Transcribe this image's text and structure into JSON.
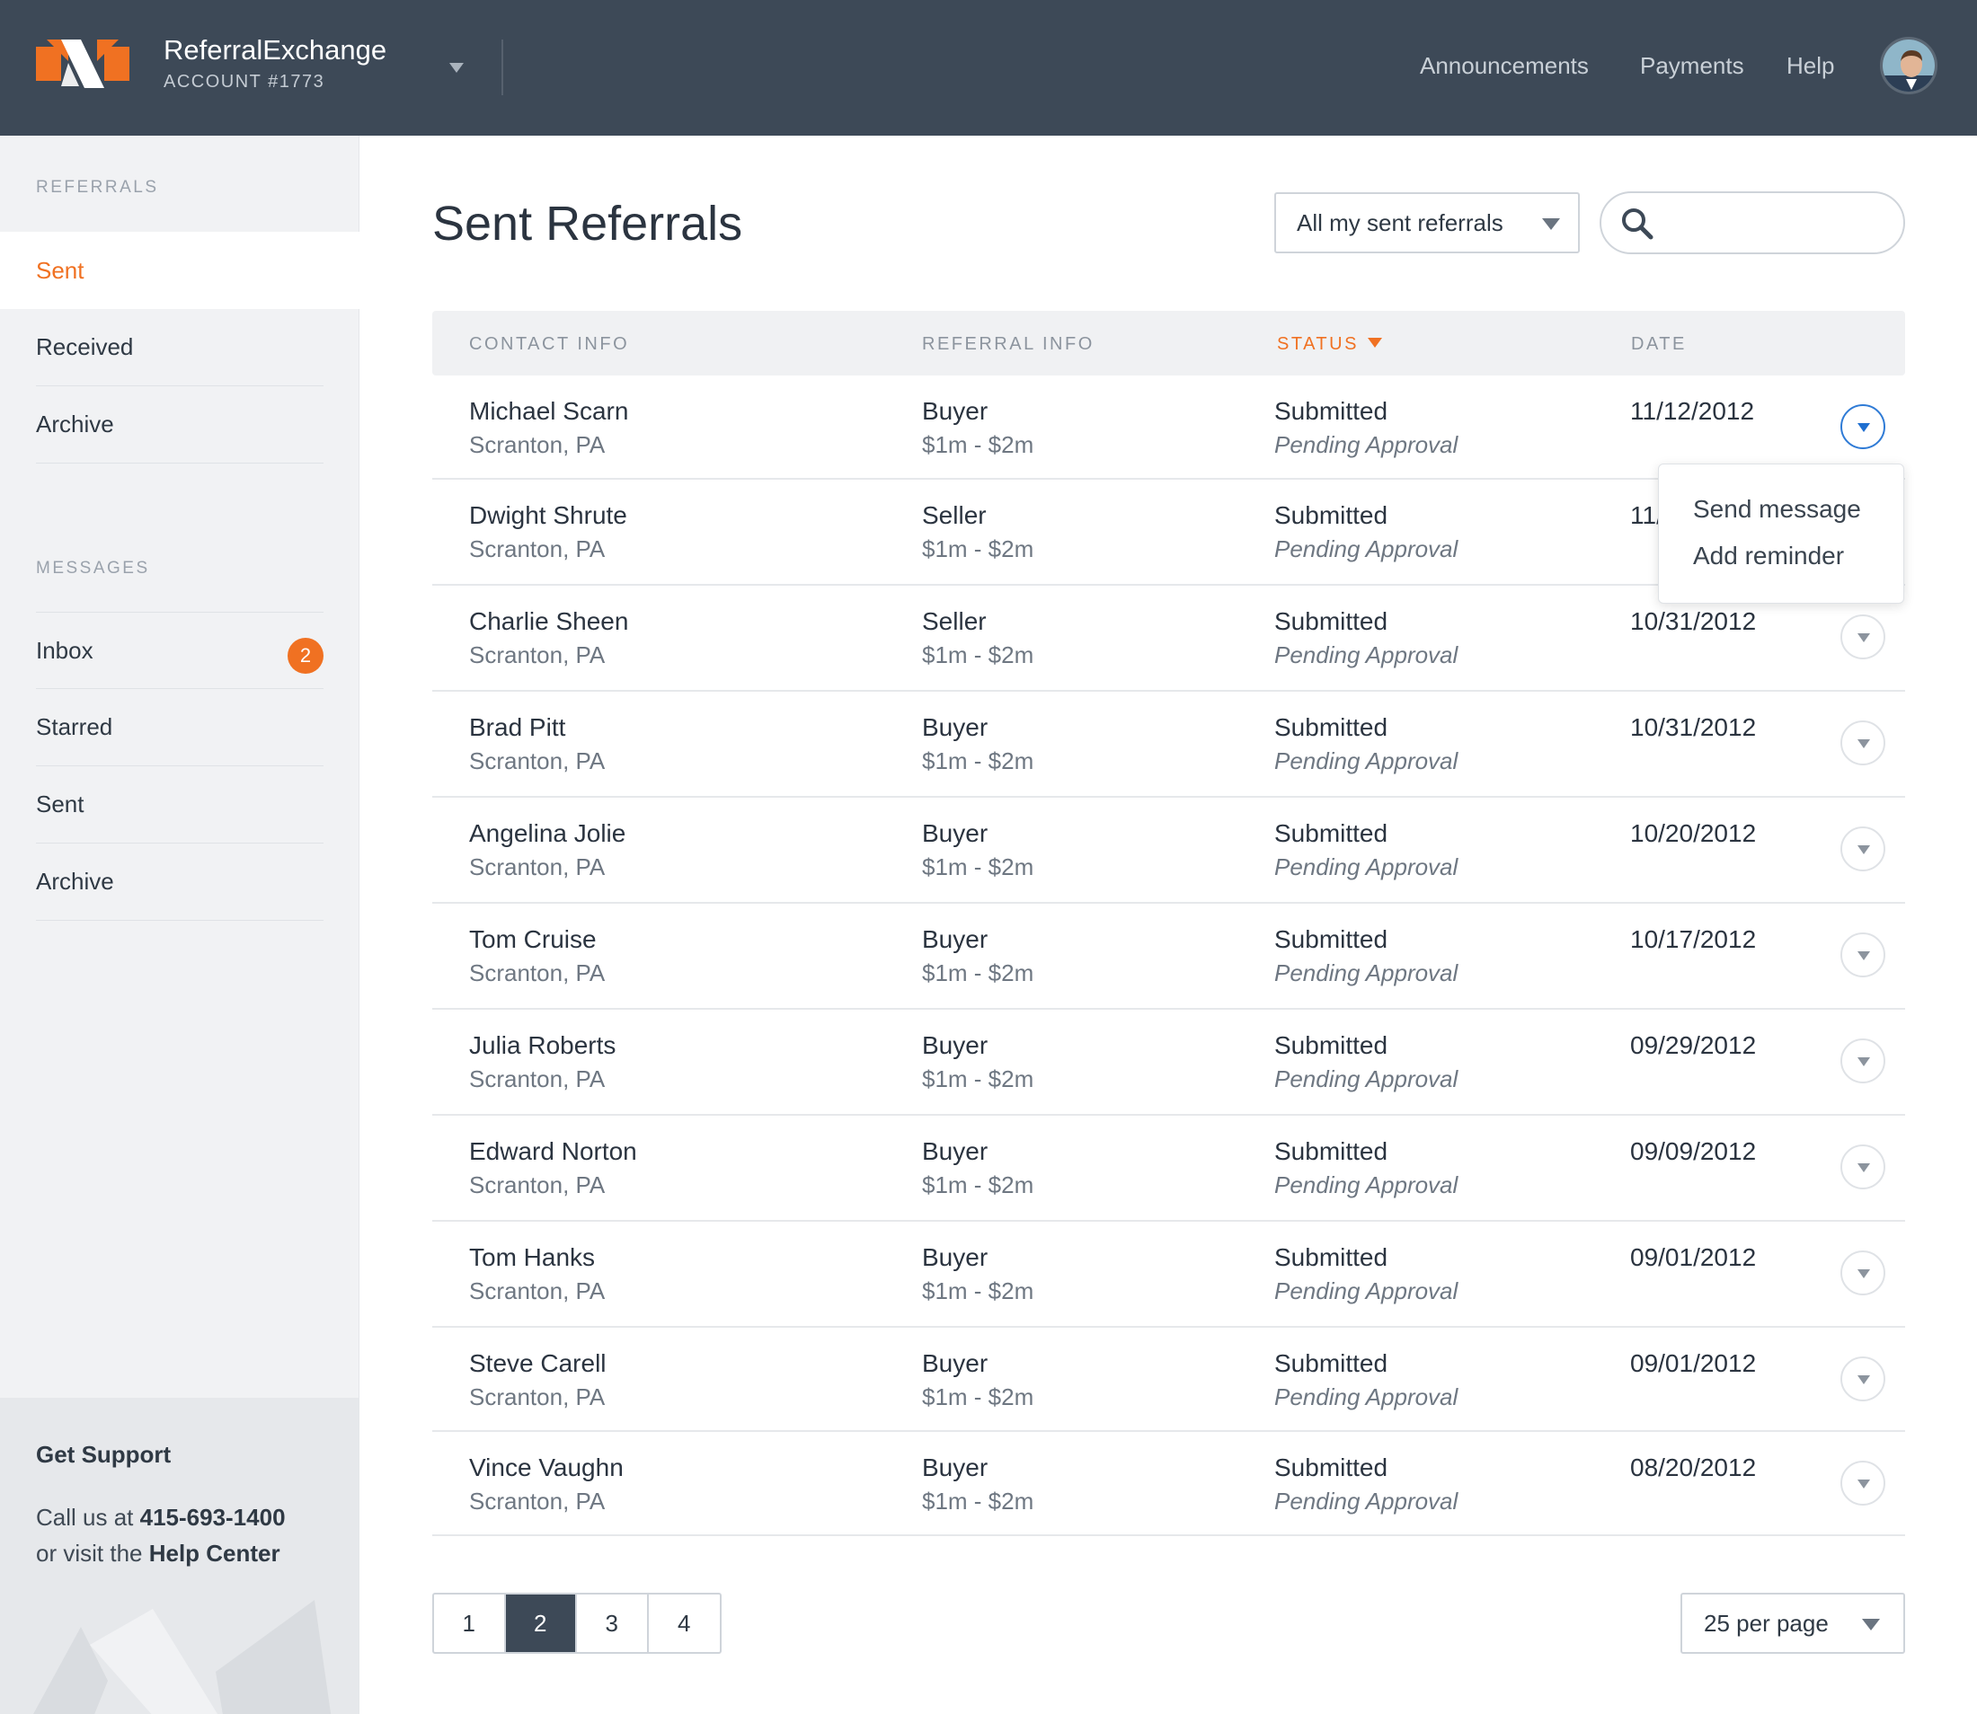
{
  "header": {
    "brand_name": "ReferralExchange",
    "account": "ACCOUNT #1773",
    "nav": [
      "Announcements",
      "Payments",
      "Help"
    ]
  },
  "sidebar": {
    "referrals_heading": "REFERRALS",
    "referral_items": [
      {
        "label": "Sent",
        "active": true
      },
      {
        "label": "Received"
      },
      {
        "label": "Archive"
      }
    ],
    "messages_heading": "MESSAGES",
    "message_items": [
      {
        "label": "Inbox",
        "badge": "2"
      },
      {
        "label": "Starred"
      },
      {
        "label": "Sent"
      },
      {
        "label": "Archive"
      }
    ],
    "support": {
      "title": "Get Support",
      "call_prefix": "Call us at ",
      "phone": "415-693-1400",
      "visit_prefix": "or visit the ",
      "help_center": "Help Center"
    }
  },
  "main": {
    "title": "Sent Referrals",
    "filter": {
      "selected": "All my sent referrals"
    },
    "search": {
      "placeholder": "",
      "value": ""
    },
    "columns": [
      "CONTACT INFO",
      "REFERRAL INFO",
      "STATUS",
      "DATE"
    ],
    "sort_column": "STATUS",
    "rows": [
      {
        "name": "Michael Scarn",
        "location": "Scranton, PA",
        "type": "Buyer",
        "range": "$1m - $2m",
        "status": "Submitted",
        "substatus": "Pending Approval",
        "date": "11/12/2012"
      },
      {
        "name": "Dwight Shrute",
        "location": "Scranton, PA",
        "type": "Seller",
        "range": "$1m - $2m",
        "status": "Submitted",
        "substatus": "Pending Approval",
        "date": "11/"
      },
      {
        "name": "Charlie Sheen",
        "location": "Scranton, PA",
        "type": "Seller",
        "range": "$1m - $2m",
        "status": "Submitted",
        "substatus": "Pending Approval",
        "date": "10/31/2012"
      },
      {
        "name": "Brad Pitt",
        "location": "Scranton, PA",
        "type": "Buyer",
        "range": "$1m - $2m",
        "status": "Submitted",
        "substatus": "Pending Approval",
        "date": "10/31/2012"
      },
      {
        "name": "Angelina Jolie",
        "location": "Scranton, PA",
        "type": "Buyer",
        "range": "$1m - $2m",
        "status": "Submitted",
        "substatus": "Pending Approval",
        "date": "10/20/2012"
      },
      {
        "name": "Tom Cruise",
        "location": "Scranton, PA",
        "type": "Buyer",
        "range": "$1m - $2m",
        "status": "Submitted",
        "substatus": "Pending Approval",
        "date": "10/17/2012"
      },
      {
        "name": "Julia Roberts",
        "location": "Scranton, PA",
        "type": "Buyer",
        "range": "$1m - $2m",
        "status": "Submitted",
        "substatus": "Pending Approval",
        "date": "09/29/2012"
      },
      {
        "name": "Edward Norton",
        "location": "Scranton, PA",
        "type": "Buyer",
        "range": "$1m - $2m",
        "status": "Submitted",
        "substatus": "Pending Approval",
        "date": "09/09/2012"
      },
      {
        "name": "Tom Hanks",
        "location": "Scranton, PA",
        "type": "Buyer",
        "range": "$1m - $2m",
        "status": "Submitted",
        "substatus": "Pending Approval",
        "date": "09/01/2012"
      },
      {
        "name": "Steve Carell",
        "location": "Scranton, PA",
        "type": "Buyer",
        "range": "$1m - $2m",
        "status": "Submitted",
        "substatus": "Pending Approval",
        "date": "09/01/2012"
      },
      {
        "name": "Vince Vaughn",
        "location": "Scranton, PA",
        "type": "Buyer",
        "range": "$1m - $2m",
        "status": "Submitted",
        "substatus": "Pending Approval",
        "date": "08/20/2012"
      }
    ],
    "row_menu": {
      "open_row": 0,
      "items": [
        "Send message",
        "Add reminder"
      ]
    },
    "pagination": {
      "pages": [
        "1",
        "2",
        "3",
        "4"
      ],
      "current": "2"
    },
    "per_page": "25 per page"
  },
  "colors": {
    "header_bg": "#3d4957",
    "accent": "#f07122",
    "sidebar_bg": "#f1f2f4"
  }
}
